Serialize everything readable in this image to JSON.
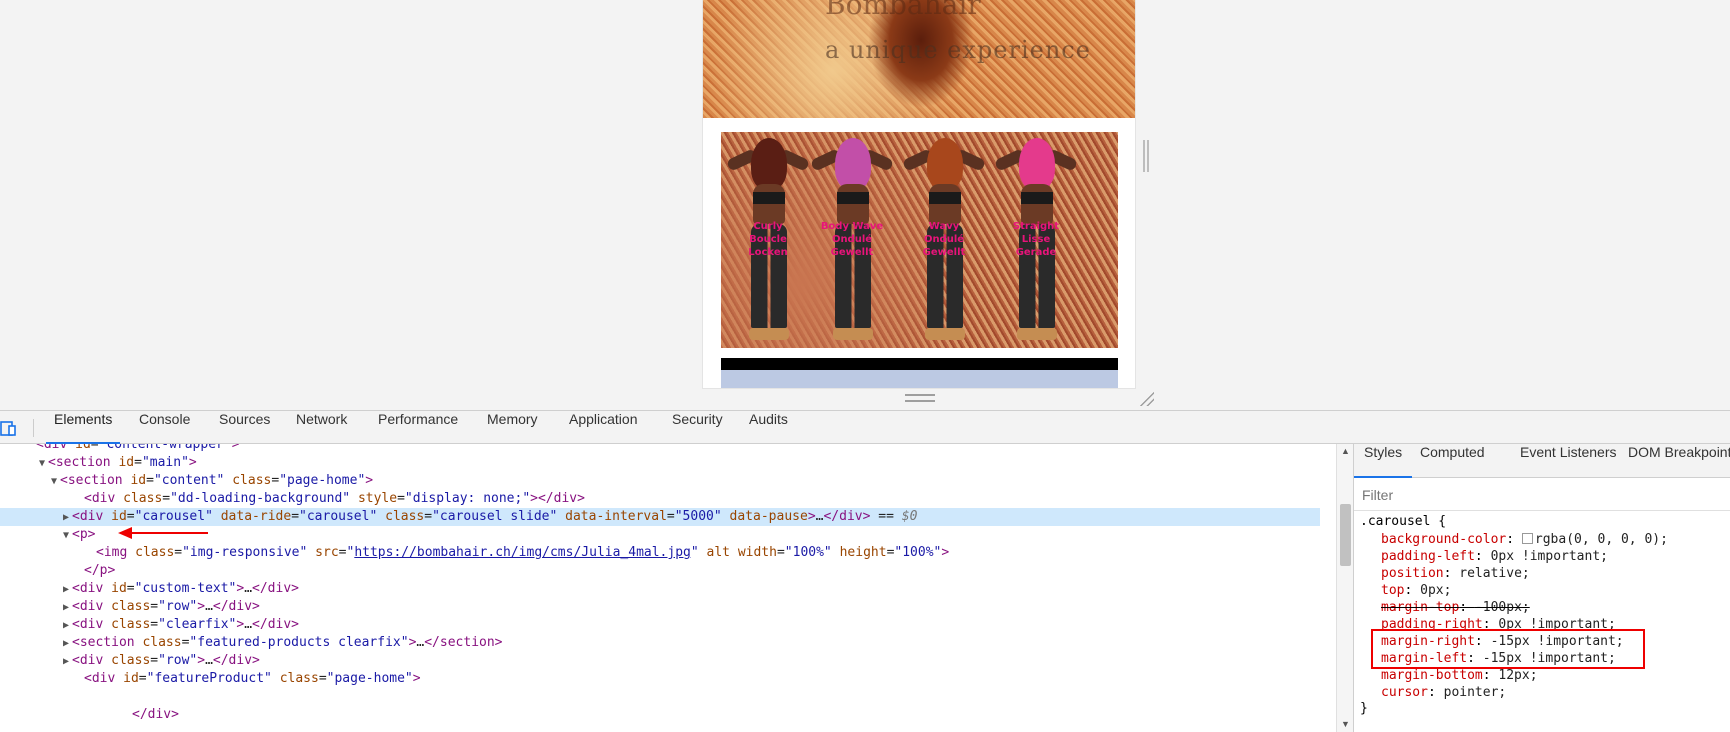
{
  "viewport": {
    "banner": {
      "brand": "Bombahair",
      "tagline": "a unique experience"
    },
    "carousel_models": [
      {
        "label": "Curly\nBoucle\nLocken",
        "hair": "#5a1e14"
      },
      {
        "label": "Body Wave\nOndulé\nGewellt",
        "hair": "#c24fa8"
      },
      {
        "label": "Wavy\nOndulé\nGewellt",
        "hair": "#a8471c"
      },
      {
        "label": "Straight\nLisse\nGerade",
        "hair": "#e43a8c"
      }
    ]
  },
  "devtools": {
    "tabs": [
      "Elements",
      "Console",
      "Sources",
      "Network",
      "Performance",
      "Memory",
      "Application",
      "Security",
      "Audits"
    ],
    "active_tab": "Elements",
    "dom_lines": [
      {
        "indent": 2,
        "tri": "",
        "html": "<span class=\"tag\">&lt;div</span> <span class=\"attr\">id</span>=<span class=\"val\">\"content-wrapper\"</span><span class=\"tag\">&gt;</span>"
      },
      {
        "indent": 3,
        "tri": "▼",
        "html": "<span class=\"tag\">&lt;section</span> <span class=\"attr\">id</span>=<span class=\"val\">\"main\"</span><span class=\"tag\">&gt;</span>"
      },
      {
        "indent": 4,
        "tri": "▼",
        "html": "<span class=\"tag\">&lt;section</span> <span class=\"attr\">id</span>=<span class=\"val\">\"content\"</span> <span class=\"attr\">class</span>=<span class=\"val\">\"page-home\"</span><span class=\"tag\">&gt;</span>"
      },
      {
        "indent": 6,
        "tri": "",
        "html": "<span class=\"tag\">&lt;div</span> <span class=\"attr\">class</span>=<span class=\"val\">\"dd-loading-background\"</span> <span class=\"attr\">style</span>=<span class=\"val\">\"display: none;\"</span><span class=\"tag\">&gt;&lt;/div&gt;</span>"
      },
      {
        "indent": 5,
        "tri": "▶",
        "selected": true,
        "html": "<span class=\"tag\">&lt;div</span> <span class=\"attr\">id</span>=<span class=\"val\">\"carousel\"</span> <span class=\"attr\">data-ride</span>=<span class=\"val\">\"carousel\"</span> <span class=\"attr\">class</span>=<span class=\"val\">\"carousel slide\"</span> <span class=\"attr\">data-interval</span>=<span class=\"val\">\"5000\"</span> <span class=\"attr\">data-pause</span><span class=\"tag\">&gt;</span>…<span class=\"tag\">&lt;/div&gt;</span> == <span class=\"ref\">$0</span>"
      },
      {
        "indent": 5,
        "tri": "▼",
        "html": "<span class=\"tag\">&lt;p&gt;</span>"
      },
      {
        "indent": 7,
        "tri": "",
        "html": "<span class=\"tag\">&lt;img</span> <span class=\"attr\">class</span>=<span class=\"val\">\"img-responsive\"</span> <span class=\"attr\">src</span>=<span class=\"val\">\"<span class=\"link\">https://bombahair.ch/img/cms/Julia_4mal.jpg</span>\"</span> <span class=\"attr\">alt</span> <span class=\"attr\">width</span>=<span class=\"val\">\"100%\"</span> <span class=\"attr\">height</span>=<span class=\"val\">\"100%\"</span><span class=\"tag\">&gt;</span>"
      },
      {
        "indent": 6,
        "tri": "",
        "html": "<span class=\"tag\">&lt;/p&gt;</span>"
      },
      {
        "indent": 5,
        "tri": "▶",
        "html": "<span class=\"tag\">&lt;div</span> <span class=\"attr\">id</span>=<span class=\"val\">\"custom-text\"</span><span class=\"tag\">&gt;</span>…<span class=\"tag\">&lt;/div&gt;</span>"
      },
      {
        "indent": 5,
        "tri": "▶",
        "html": "<span class=\"tag\">&lt;div</span> <span class=\"attr\">class</span>=<span class=\"val\">\"row\"</span><span class=\"tag\">&gt;</span>…<span class=\"tag\">&lt;/div&gt;</span>"
      },
      {
        "indent": 5,
        "tri": "▶",
        "html": "<span class=\"tag\">&lt;div</span> <span class=\"attr\">class</span>=<span class=\"val\">\"clearfix\"</span><span class=\"tag\">&gt;</span>…<span class=\"tag\">&lt;/div&gt;</span>"
      },
      {
        "indent": 5,
        "tri": "▶",
        "html": "<span class=\"tag\">&lt;section</span> <span class=\"attr\">class</span>=<span class=\"val\">\"featured-products clearfix\"</span><span class=\"tag\">&gt;</span>…<span class=\"tag\">&lt;/section&gt;</span>"
      },
      {
        "indent": 5,
        "tri": "▶",
        "html": "<span class=\"tag\">&lt;div</span> <span class=\"attr\">class</span>=<span class=\"val\">\"row\"</span><span class=\"tag\">&gt;</span>…<span class=\"tag\">&lt;/div&gt;</span>"
      },
      {
        "indent": 6,
        "tri": "",
        "html": "<span class=\"tag\">&lt;div</span> <span class=\"attr\">id</span>=<span class=\"val\">\"featureProduct\"</span> <span class=\"attr\">class</span>=<span class=\"val\">\"page-home\"</span><span class=\"tag\">&gt;</span>"
      },
      {
        "indent": 0,
        "tri": "",
        "html": ""
      },
      {
        "indent": 10,
        "tri": "",
        "html": "<span class=\"tag\">&lt;/div&gt;</span>"
      }
    ],
    "styles_tabs": [
      "Styles",
      "Computed",
      "Event Listeners",
      "DOM Breakpoints"
    ],
    "filter_placeholder": "Filter",
    "selector": ".carousel {",
    "closing": "}",
    "declarations": [
      {
        "prop": "background-color",
        "value": "rgba(0, 0, 0, 0);",
        "swatch": true
      },
      {
        "prop": "padding-left",
        "value": "0px !important;"
      },
      {
        "prop": "position",
        "value": "relative;"
      },
      {
        "prop": "top",
        "value": "0px;"
      },
      {
        "prop": "margin-top",
        "value": "-100px;",
        "struck": true
      },
      {
        "prop": "padding-right",
        "value": "0px !important;"
      },
      {
        "prop": "margin-right",
        "value": "-15px !important;"
      },
      {
        "prop": "margin-left",
        "value": "-15px !important;"
      },
      {
        "prop": "margin-bottom",
        "value": "12px;"
      },
      {
        "prop": "cursor",
        "value": "pointer;"
      }
    ]
  }
}
